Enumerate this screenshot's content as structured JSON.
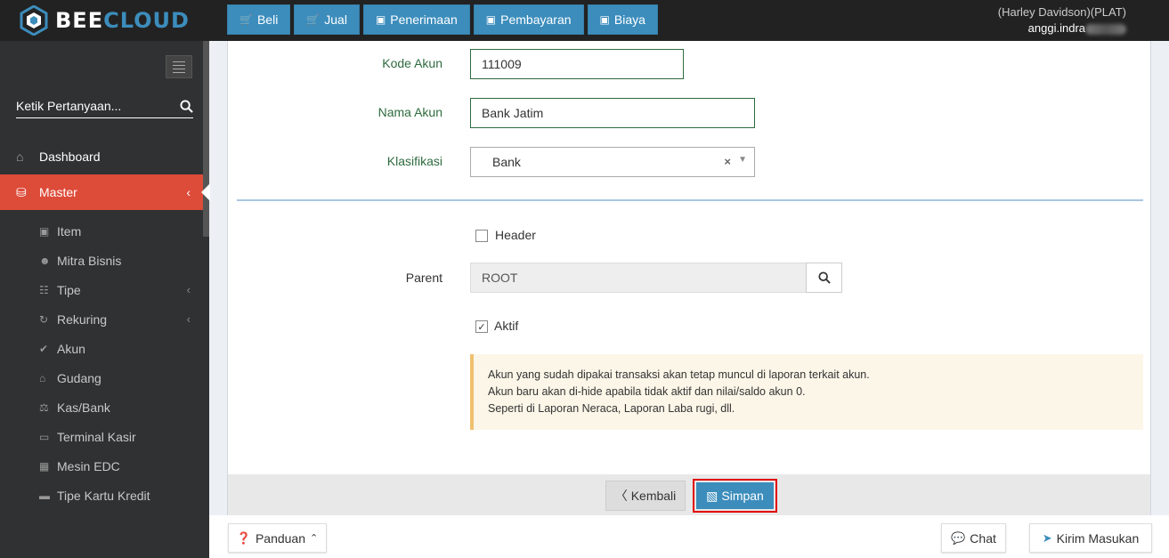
{
  "brand": {
    "bee": "BEE",
    "cloud": "CLOUD"
  },
  "topnav": [
    {
      "label": "Beli",
      "icon": "cart-icon"
    },
    {
      "label": "Jual",
      "icon": "cart-icon"
    },
    {
      "label": "Penerimaan",
      "icon": "money-icon"
    },
    {
      "label": "Pembayaran",
      "icon": "money-icon"
    },
    {
      "label": "Biaya",
      "icon": "money-icon"
    }
  ],
  "user": {
    "company": "(Harley Davidson)(PLAT)",
    "name": "anggi.indra"
  },
  "sidebar": {
    "search_placeholder": "Ketik Pertanyaan...",
    "dashboard": "Dashboard",
    "master": "Master",
    "items": [
      {
        "label": "Item",
        "icon": "cube-icon"
      },
      {
        "label": "Mitra Bisnis",
        "icon": "users-icon"
      },
      {
        "label": "Tipe",
        "icon": "sitemap-icon"
      },
      {
        "label": "Rekuring",
        "icon": "refresh-icon"
      },
      {
        "label": "Akun",
        "icon": "check-icon"
      },
      {
        "label": "Gudang",
        "icon": "home-icon"
      },
      {
        "label": "Kas/Bank",
        "icon": "bank-icon"
      },
      {
        "label": "Terminal Kasir",
        "icon": "monitor-icon"
      },
      {
        "label": "Mesin EDC",
        "icon": "calculator-icon"
      },
      {
        "label": "Tipe Kartu Kredit",
        "icon": "credit-card-icon"
      }
    ]
  },
  "form": {
    "kode_akun_label": "Kode Akun",
    "kode_akun_value": "111009",
    "nama_akun_label": "Nama Akun",
    "nama_akun_value": "Bank Jatim",
    "klasifikasi_label": "Klasifikasi",
    "klasifikasi_value": "Bank",
    "header_label": "Header",
    "header_checked": false,
    "parent_label": "Parent",
    "parent_value": "ROOT",
    "aktif_label": "Aktif",
    "aktif_checked": true,
    "note_lines": [
      "Akun yang sudah dipakai transaksi akan tetap muncul di laporan terkait akun.",
      "Akun baru akan di-hide apabila tidak aktif dan nilai/saldo akun 0.",
      "Seperti di Laporan Neraca, Laporan Laba rugi, dll."
    ]
  },
  "actions": {
    "back": "Kembali",
    "save": "Simpan"
  },
  "bottom": {
    "guide": "Panduan",
    "chat": "Chat",
    "feedback": "Kirim Masukan"
  },
  "colors": {
    "primary": "#3c8dbc",
    "active_menu": "#dd4b39",
    "highlight": "#e00000"
  }
}
